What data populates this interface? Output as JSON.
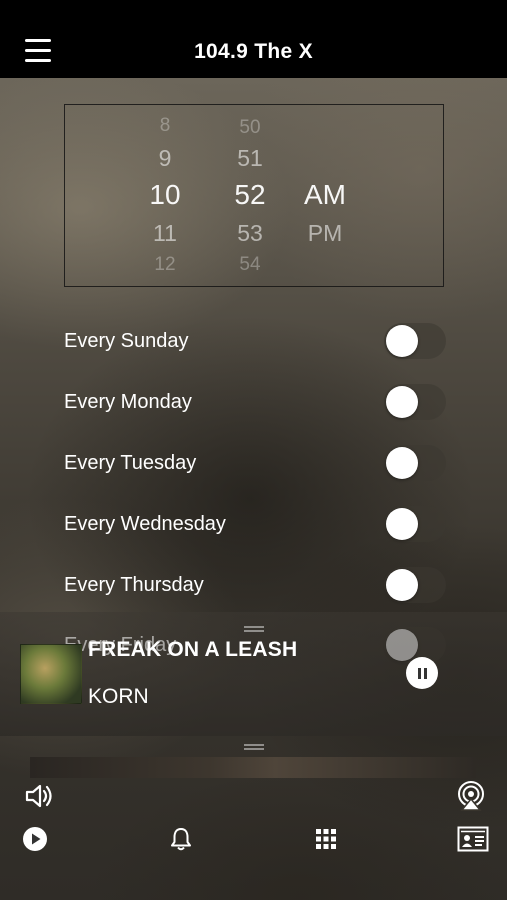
{
  "header": {
    "title": "104.9 The X"
  },
  "time_picker": {
    "hours": [
      "8",
      "9",
      "10",
      "11",
      "12"
    ],
    "minutes": [
      "50",
      "51",
      "52",
      "53",
      "54"
    ],
    "periods": [
      "AM",
      "PM"
    ],
    "selected": {
      "hour": "10",
      "minute": "52",
      "period": "AM"
    }
  },
  "days": [
    {
      "label": "Every Sunday",
      "on": false
    },
    {
      "label": "Every Monday",
      "on": false
    },
    {
      "label": "Every Tuesday",
      "on": false
    },
    {
      "label": "Every Wednesday",
      "on": false
    },
    {
      "label": "Every Thursday",
      "on": false
    },
    {
      "label": "Every Friday",
      "on": false
    }
  ],
  "now_playing": {
    "track": "FREAK ON A LEASH",
    "artist": "KORN",
    "state": "playing"
  },
  "icons": {
    "menu": "hamburger-menu-icon",
    "volume": "speaker-volume-icon",
    "airplay": "airplay-icon",
    "play": "play-circle-icon",
    "alarm": "bell-icon",
    "grid": "grid-icon",
    "contact": "contact-card-icon"
  },
  "colors": {
    "header_bg": "#000000",
    "toggle_knob": "#ffffff"
  }
}
